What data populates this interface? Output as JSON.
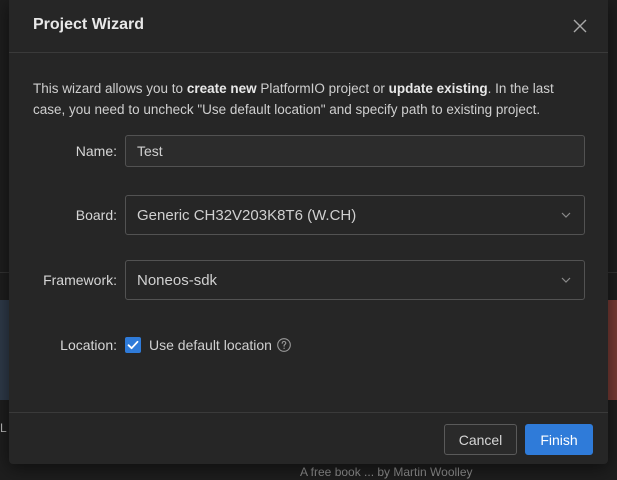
{
  "dialog": {
    "title": "Project Wizard",
    "intro": {
      "part1": "This wizard allows you to ",
      "bold1": "create new",
      "part2": " PlatformIO project or ",
      "bold2": "update existing",
      "part3": ". In the last case, you need to uncheck \"Use default location\" and specify path to existing project."
    },
    "fields": {
      "name_label": "Name:",
      "name_value": "Test",
      "board_label": "Board:",
      "board_value": "Generic CH32V203K8T6 (W.CH)",
      "framework_label": "Framework:",
      "framework_value": "Noneos-sdk",
      "location_label": "Location:",
      "use_default_location_label": "Use default location",
      "use_default_location_checked": true
    },
    "footer": {
      "cancel_label": "Cancel",
      "finish_label": "Finish"
    },
    "icons": {
      "close": "close-icon",
      "chevron": "chevron-down-icon",
      "check": "check-icon",
      "help": "help-circle-icon"
    },
    "colors": {
      "accent": "#2f7bd9",
      "background": "#262626",
      "border": "#525252"
    }
  },
  "background": {
    "left_fragment": "L",
    "bottom_fragment": "A free book ... by Martin Woolley"
  }
}
